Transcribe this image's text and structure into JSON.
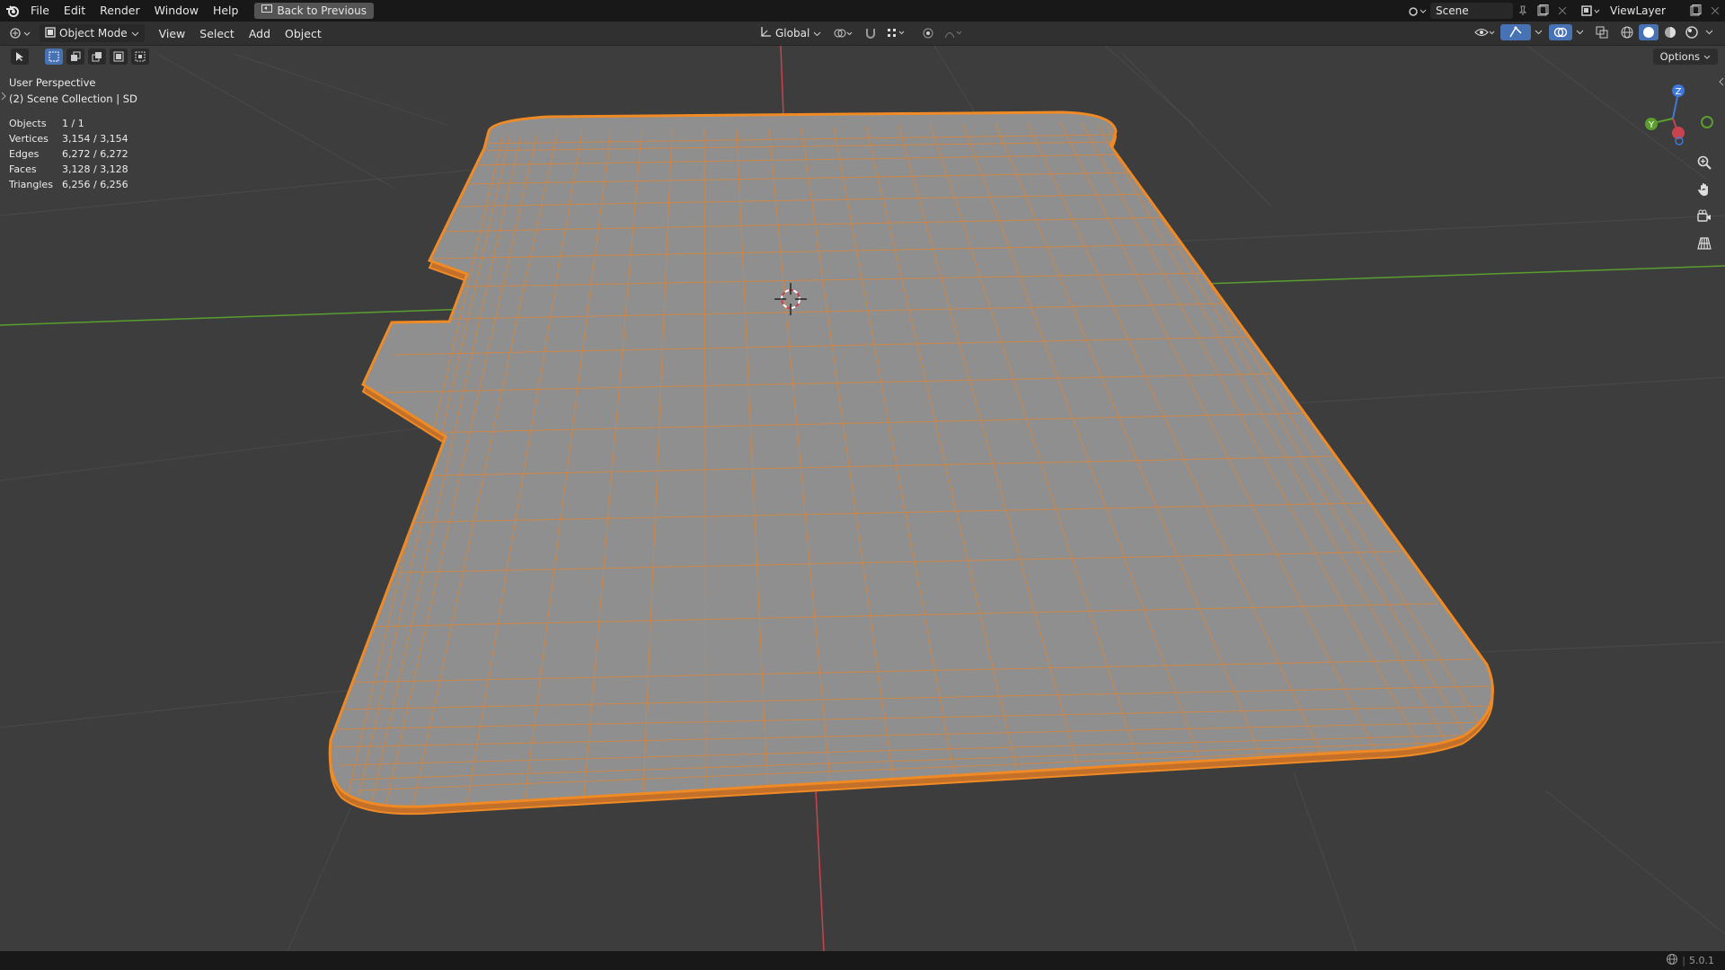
{
  "menubar": {
    "items": [
      "File",
      "Edit",
      "Render",
      "Window",
      "Help"
    ],
    "back_button": "Back to Previous"
  },
  "scene": {
    "name": "Scene"
  },
  "view_layer": {
    "name": "ViewLayer"
  },
  "header": {
    "mode": "Object Mode",
    "menus": [
      "View",
      "Select",
      "Add",
      "Object"
    ],
    "transform_orientation": "Global",
    "options": "Options"
  },
  "overlay": {
    "perspective": "User Perspective",
    "collection": "(2) Scene Collection | SD",
    "stats": [
      {
        "label": "Objects",
        "value": "1 / 1"
      },
      {
        "label": "Vertices",
        "value": "3,154 / 3,154"
      },
      {
        "label": "Edges",
        "value": "6,272 / 6,272"
      },
      {
        "label": "Faces",
        "value": "3,128 / 3,128"
      },
      {
        "label": "Triangles",
        "value": "6,256 / 6,256"
      }
    ]
  },
  "gizmo": {
    "z": "Z",
    "y": "Y"
  },
  "statusbar": {
    "version": "5.0.1"
  },
  "colors": {
    "selection_outline": "#f08a24",
    "mesh_face": "#8f8f8f",
    "x_axis": "#c7444f",
    "y_axis": "#5a9e2e",
    "z_axis": "#3f78d8",
    "active_tool": "#4772b3"
  }
}
